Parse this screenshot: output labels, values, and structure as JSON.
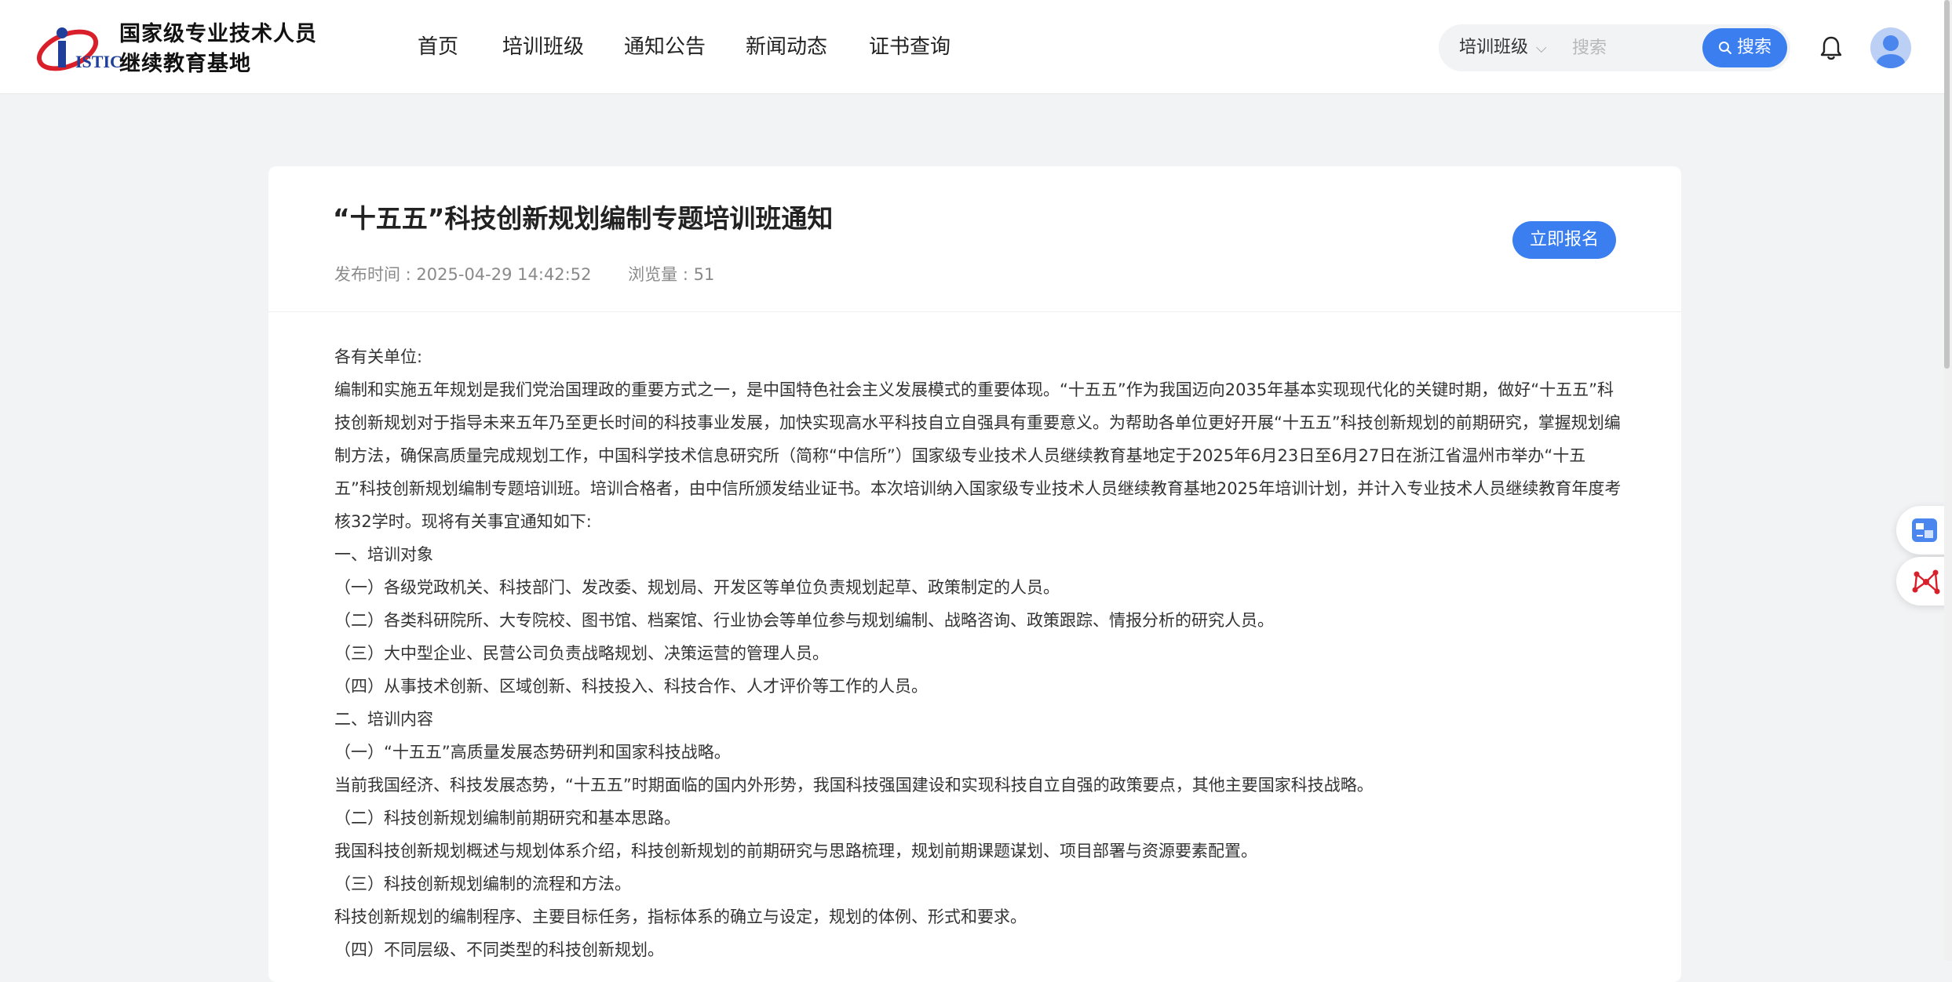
{
  "header": {
    "logo_mark": "ISTIC",
    "logo_line1": "国家级专业技术人员",
    "logo_line2": "继续教育基地",
    "nav": [
      {
        "label": "首页"
      },
      {
        "label": "培训班级"
      },
      {
        "label": "通知公告"
      },
      {
        "label": "新闻动态"
      },
      {
        "label": "证书查询"
      }
    ],
    "search": {
      "category": "培训班级",
      "placeholder": "搜索",
      "button_label": "搜索"
    }
  },
  "article": {
    "title": "“十五五”科技创新规划编制专题培训班通知",
    "publish_time": "发布时间 : 2025-04-29 14:42:52",
    "views": "浏览量 : 51",
    "enroll_label": "立即报名",
    "paragraphs": [
      "各有关单位:",
      "编制和实施五年规划是我们党治国理政的重要方式之一，是中国特色社会主义发展模式的重要体现。“十五五”作为我国迈向2035年基本实现现代化的关键时期，做好“十五五”科技创新规划对于指导未来五年乃至更长时间的科技事业发展，加快实现高水平科技自立自强具有重要意义。为帮助各单位更好开展“十五五”科技创新规划的前期研究，掌握规划编制方法，确保高质量完成规划工作，中国科学技术信息研究所（简称“中信所”）国家级专业技术人员继续教育基地定于2025年6月23日至6月27日在浙江省温州市举办“十五五”科技创新规划编制专题培训班。培训合格者，由中信所颁发结业证书。本次培训纳入国家级专业技术人员继续教育基地2025年培训计划，并计入专业技术人员继续教育年度考核32学时。现将有关事宜通知如下:",
      "一、培训对象",
      "（一）各级党政机关、科技部门、发改委、规划局、开发区等单位负责规划起草、政策制定的人员。",
      "（二）各类科研院所、大专院校、图书馆、档案馆、行业协会等单位参与规划编制、战略咨询、政策跟踪、情报分析的研究人员。",
      "（三）大中型企业、民营公司负责战略规划、决策运营的管理人员。",
      "（四）从事技术创新、区域创新、科技投入、科技合作、人才评价等工作的人员。",
      "二、培训内容",
      "（一）“十五五”高质量发展态势研判和国家科技战略。",
      "当前我国经济、科技发展态势，“十五五”时期面临的国内外形势，我国科技强国建设和实现科技自立自强的政策要点，其他主要国家科技战略。",
      "（二）科技创新规划编制前期研究和基本思路。",
      "我国科技创新规划概述与规划体系介绍，科技创新规划的前期研究与思路梳理，规划前期课题谋划、项目部署与资源要素配置。",
      "（三）科技创新规划编制的流程和方法。",
      "科技创新规划的编制程序、主要目标任务，指标体系的确立与设定，规划的体例、形式和要求。",
      "（四）不同层级、不同类型的科技创新规划。"
    ]
  },
  "tools": {
    "translate_icon": "translate-icon",
    "ai_icon": "network-icon"
  },
  "colors": {
    "accent": "#3a7ef0",
    "logo_red": "#d9202a",
    "logo_blue": "#1f3f9a"
  }
}
